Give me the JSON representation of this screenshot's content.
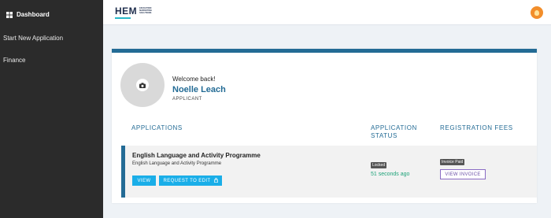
{
  "sidebar": {
    "items": [
      {
        "label": "Dashboard",
        "active": true
      },
      {
        "label": "Start New Application",
        "active": false
      },
      {
        "label": "Finance",
        "active": false
      }
    ]
  },
  "topbar": {
    "logo_text": "HEM",
    "logo_tagline_1": "EDUCATION",
    "logo_tagline_2": "MARKETING",
    "logo_tagline_3": "SOLUTIONS",
    "user_icon": "lightbulb-icon",
    "user_icon_color": "#f28e2b"
  },
  "profile": {
    "welcome": "Welcome back!",
    "name": "Noelle Leach",
    "role": "APPLICANT",
    "avatar_icon": "camera-icon"
  },
  "columns": {
    "applications": "APPLICATIONS",
    "status_line1": "APPLICATION",
    "status_line2": "STATUS",
    "fees": "REGISTRATION FEES"
  },
  "application": {
    "title": "English Language and Activity Programme",
    "subtitle": "English Language and Activity Programme",
    "view_label": "VIEW",
    "request_label": "REQUEST TO EDIT",
    "status_badge": "Locked",
    "status_time": "51 seconds ago",
    "fee_badge": "Invoice Paid",
    "view_invoice_label": "VIEW INVOICE"
  },
  "colors": {
    "sidebar_bg": "#2b2b2b",
    "accent": "#236b95",
    "button": "#1aaee8",
    "status_green": "#1fa37a",
    "invoice_purple": "#6b50a8"
  }
}
